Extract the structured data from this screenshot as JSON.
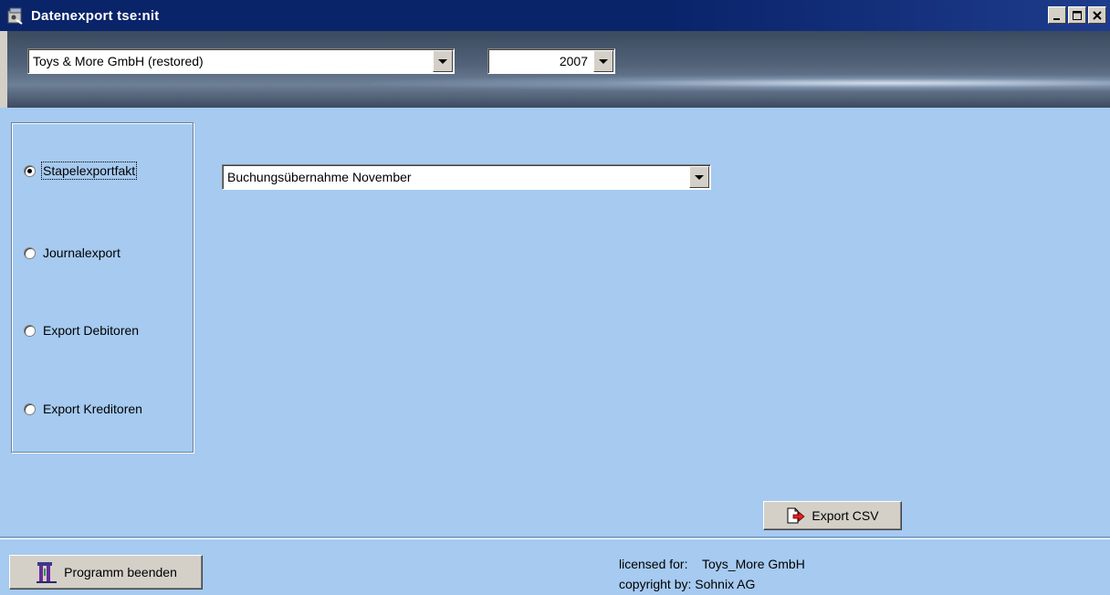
{
  "window": {
    "title": "Datenexport tse:nit"
  },
  "header": {
    "company_select": {
      "value": "Toys & More GmbH (restored)"
    },
    "year_select": {
      "value": "2007"
    }
  },
  "export_options": [
    {
      "label": "Stapelexportfakt",
      "selected": true
    },
    {
      "label": "Journalexport",
      "selected": false
    },
    {
      "label": "Export Debitoren",
      "selected": false
    },
    {
      "label": "Export Kreditoren",
      "selected": false
    }
  ],
  "batch_select": {
    "value": "Buchungsübernahme November"
  },
  "actions": {
    "export_label": "Export CSV",
    "quit_label": "Programm beenden"
  },
  "footer": {
    "licensed_for_label": "licensed for:",
    "licensed_for_value": "Toys_More GmbH",
    "copyright": "copyright by: Sohnix AG"
  },
  "colors": {
    "titlebar": "#0a246a",
    "main_background": "#a6caf0",
    "chrome": "#d4d0c8"
  }
}
